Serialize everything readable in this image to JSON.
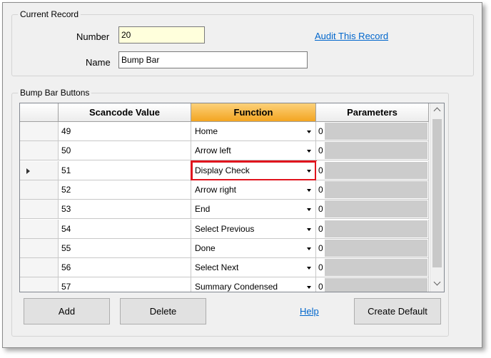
{
  "current_record": {
    "title": "Current Record",
    "number_label": "Number",
    "number_value": "20",
    "name_label": "Name",
    "name_value": "Bump Bar",
    "audit_link": "Audit This Record"
  },
  "bump_bar": {
    "title": "Bump Bar Buttons",
    "columns": {
      "scancode": "Scancode Value",
      "function": "Function",
      "parameters": "Parameters"
    },
    "rows": [
      {
        "scancode": "49",
        "function": "Home",
        "parameters": "0"
      },
      {
        "scancode": "50",
        "function": "Arrow left",
        "parameters": "0"
      },
      {
        "scancode": "51",
        "function": "Display Check",
        "parameters": "0"
      },
      {
        "scancode": "52",
        "function": "Arrow right",
        "parameters": "0"
      },
      {
        "scancode": "53",
        "function": "End",
        "parameters": "0"
      },
      {
        "scancode": "54",
        "function": "Select Previous",
        "parameters": "0"
      },
      {
        "scancode": "55",
        "function": "Done",
        "parameters": "0"
      },
      {
        "scancode": "56",
        "function": "Select Next",
        "parameters": "0"
      },
      {
        "scancode": "57",
        "function": "Summary Condensed",
        "parameters": "0"
      }
    ],
    "current_row": 2,
    "highlight_color": "#e0141e",
    "function_header_color": "#f3a521",
    "buttons": {
      "add": "Add",
      "delete": "Delete",
      "help": "Help",
      "create_default": "Create Default"
    }
  }
}
